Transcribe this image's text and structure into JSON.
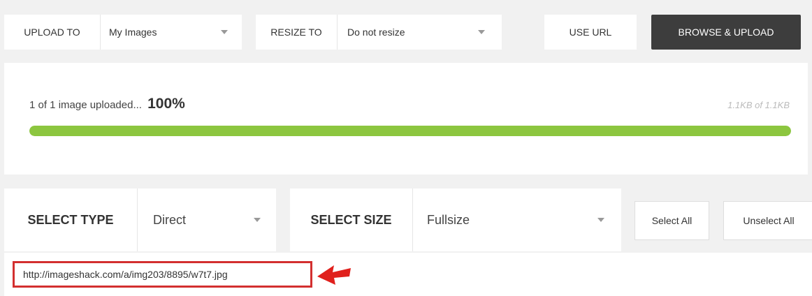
{
  "toolbar": {
    "upload_to_label": "UPLOAD TO",
    "upload_to_value": "My Images",
    "resize_to_label": "RESIZE TO",
    "resize_to_value": "Do not resize",
    "use_url_label": "USE URL",
    "browse_upload_label": "BROWSE & UPLOAD"
  },
  "progress": {
    "status_text": "1 of 1 image uploaded...",
    "percent_text": "100%",
    "percent": 100,
    "size_text": "1.1KB of 1.1KB",
    "color": "#8cc63f"
  },
  "selection": {
    "type_label": "SELECT TYPE",
    "type_value": "Direct",
    "size_label": "SELECT SIZE",
    "size_value": "Fullsize",
    "select_all_label": "Select All",
    "unselect_all_label": "Unselect All"
  },
  "result": {
    "url": "http://imageshack.com/a/img203/8895/w7t7.jpg",
    "highlight_color": "#d32f2f"
  },
  "icons": {
    "dropdown": "chevron-down-icon",
    "annotation": "arrow-left-icon"
  }
}
